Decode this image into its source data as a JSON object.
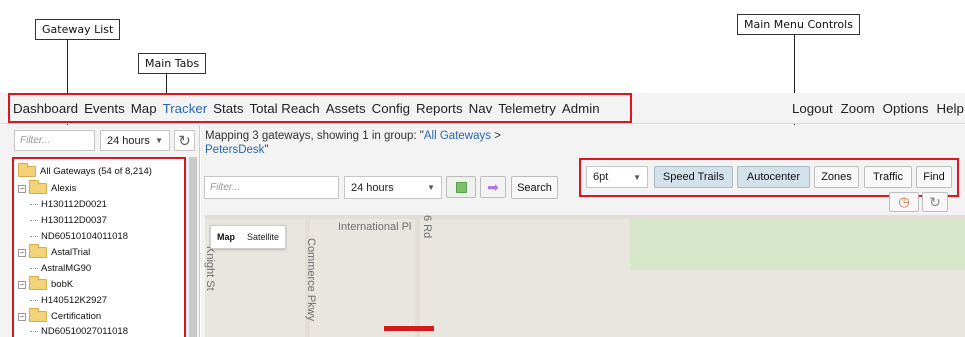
{
  "callouts": {
    "gateway_list": "Gateway List",
    "main_tabs": "Main Tabs",
    "main_menu_controls": "Main Menu Controls"
  },
  "menu": {
    "tabs": [
      "Dashboard",
      "Events",
      "Map",
      "Tracker",
      "Stats",
      "Total Reach",
      "Assets",
      "Config",
      "Reports",
      "Nav",
      "Telemetry",
      "Admin"
    ],
    "active_tab": "Tracker",
    "right_items": [
      "Logout",
      "Zoom",
      "Options",
      "Help"
    ]
  },
  "left_panel": {
    "filter_placeholder": "Filter...",
    "time_select": "24 hours",
    "refresh_icon": "refresh-icon",
    "tree": [
      {
        "label": "All Gateways (54 of 8,214)",
        "type": "root"
      },
      {
        "label": "Alexis",
        "type": "group"
      },
      {
        "label": "H130112D0021",
        "type": "leaf"
      },
      {
        "label": "H130112D0037",
        "type": "leaf"
      },
      {
        "label": "ND60510104011018",
        "type": "leaf"
      },
      {
        "label": "AstalTrial",
        "type": "group"
      },
      {
        "label": "AstralMG90",
        "type": "leaf"
      },
      {
        "label": "bobK",
        "type": "group"
      },
      {
        "label": "H140512K2927",
        "type": "leaf"
      },
      {
        "label": "Certification",
        "type": "group"
      },
      {
        "label": "ND60510027011018",
        "type": "leaf"
      }
    ]
  },
  "main": {
    "heading_prefix": "Mapping 3 gateways, showing 1 in group: \"",
    "heading_link1": "All Gateways",
    "heading_sep": " >",
    "heading_link2": "PetersDesk",
    "heading_suffix": "\"",
    "filter_placeholder": "Filter...",
    "time_select": "24 hours",
    "search_label": "Search"
  },
  "controls": {
    "size_select": "6pt",
    "speed_trails": "Speed Trails",
    "autocenter": "Autocenter",
    "zones": "Zones",
    "traffic": "Traffic",
    "find": "Find"
  },
  "map": {
    "map_type": "Map",
    "satellite_type": "Satellite",
    "streets": [
      "International Pl",
      "Commerce Pkwy",
      "Knight St",
      "6 Rd"
    ]
  },
  "colors": {
    "accent": "#2a67b1",
    "highlight": "#e0141e",
    "active_button": "#d3e2ea"
  }
}
